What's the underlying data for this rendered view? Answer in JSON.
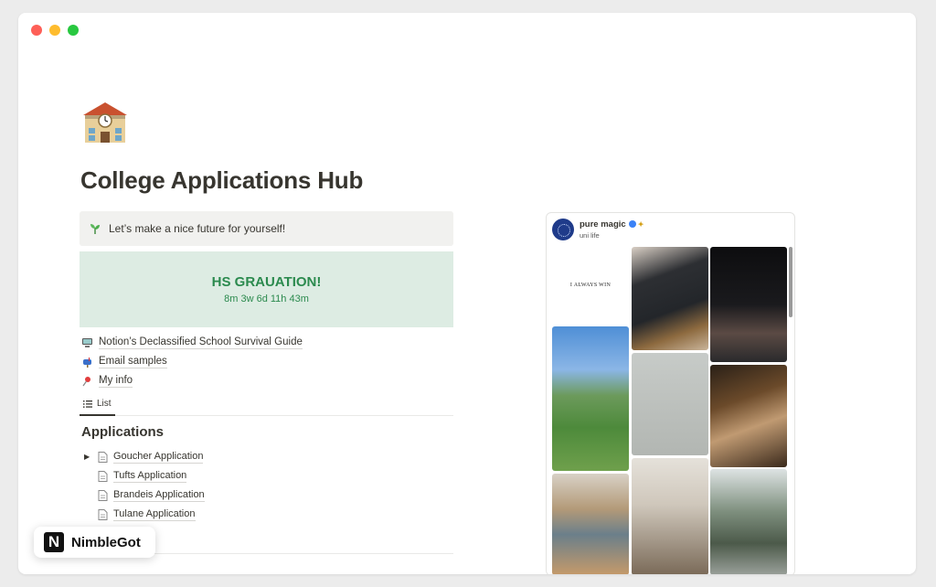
{
  "page": {
    "title": "College Applications Hub",
    "icon": "school-building-icon"
  },
  "callout": {
    "icon": "seedling-icon",
    "text": "Let’s make a nice future for yourself!"
  },
  "countdown": {
    "title": "HS GRAUATION!",
    "time": "8m 3w 6d 11h 43m"
  },
  "links": [
    {
      "icon": "computer-icon",
      "label": "Notion’s Declassified School Survival Guide"
    },
    {
      "icon": "mailbox-icon",
      "label": "Email samples"
    },
    {
      "icon": "pushpin-icon",
      "label": "My info"
    }
  ],
  "view": {
    "tab_label": "List"
  },
  "applications": {
    "title": "Applications",
    "items": [
      {
        "label": "Goucher Application",
        "has_toggle": true
      },
      {
        "label": "Tufts Application",
        "has_toggle": false
      },
      {
        "label": "Brandeis Application",
        "has_toggle": false
      },
      {
        "label": "Tulane Application",
        "has_toggle": false
      }
    ]
  },
  "embed": {
    "profile_name": "pure magic",
    "profile_bio": "uni life",
    "first_tile_text": "I ALWAYS WIN"
  },
  "brand": {
    "logo_letter": "N",
    "name": "NimbleGot"
  },
  "colors": {
    "countdown_bg": "#ddece3",
    "countdown_text": "#2b8a4e",
    "callout_bg": "#f1f1ef"
  }
}
